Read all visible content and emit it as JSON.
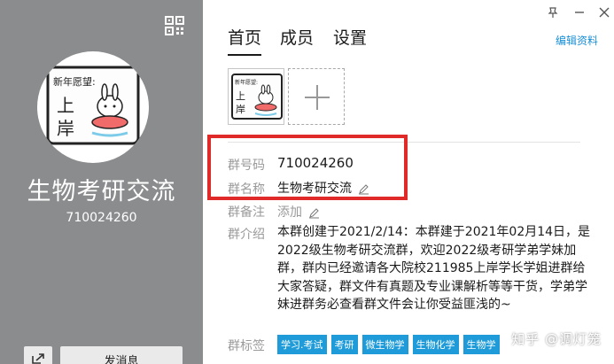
{
  "group": {
    "name": "生物考研交流",
    "number": "710024260"
  },
  "avatar": {
    "line1": "新年愿望:",
    "line2": "上",
    "line3": "岸"
  },
  "left_panel": {
    "send_message_label": "发消息"
  },
  "tabs": [
    {
      "label": "首页"
    },
    {
      "label": "成员"
    },
    {
      "label": "设置"
    }
  ],
  "edit_profile_label": "编辑资料",
  "info": {
    "number_label": "群号码",
    "name_label": "群名称",
    "remark_label": "群备注",
    "remark_value": "添加",
    "intro_label": "群介绍",
    "intro_text": "本群创建于2021/2/14：本群建于2021年02月14日，是2022级生物考研交流群，欢迎2022级考研学弟学妹加群，群内已经邀请各大院校211985上岸学长学姐进群给大家答疑，群文件有真题及专业课解析等等干货，学弟学妹进群务必查看群文件会让你受益匪浅的~",
    "tags_label": "群标签",
    "tags": [
      "学习.考试",
      "考研",
      "微生物学",
      "生物化学",
      "生物学"
    ]
  },
  "watermark": "知乎 @调灯笼",
  "colors": {
    "left_panel_bg": "#8a8c8e",
    "accent": "#1a8fd6",
    "tag_bg": "#1e9bd8",
    "highlight_border": "#e02a2a"
  },
  "icons": [
    "qr-code-icon",
    "share-icon",
    "pin-icon",
    "minimize-icon",
    "close-icon",
    "pencil-icon",
    "plus-icon"
  ]
}
